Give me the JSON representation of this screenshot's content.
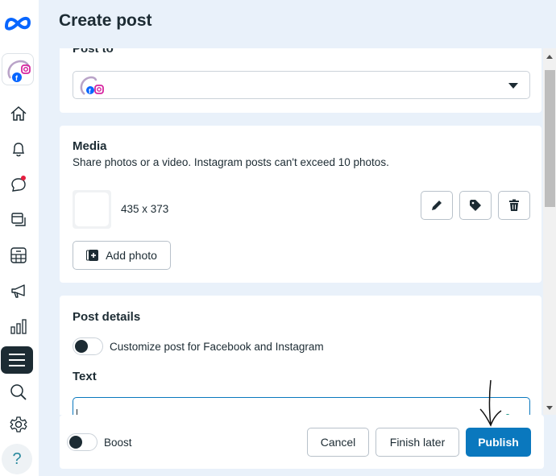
{
  "header": {
    "title": "Create post"
  },
  "sidebar": {
    "items": [
      {
        "name": "home",
        "icon": "home-icon"
      },
      {
        "name": "notifications",
        "icon": "bell-icon"
      },
      {
        "name": "inbox",
        "icon": "chat-bubble-icon",
        "has_badge": true
      },
      {
        "name": "content",
        "icon": "content-stack-icon"
      },
      {
        "name": "planner",
        "icon": "calendar-grid-icon"
      },
      {
        "name": "ads",
        "icon": "megaphone-icon"
      },
      {
        "name": "insights",
        "icon": "bar-chart-icon"
      },
      {
        "name": "all-tools",
        "icon": "hamburger-menu-icon",
        "active": true
      },
      {
        "name": "search",
        "icon": "search-icon"
      },
      {
        "name": "settings",
        "icon": "gear-icon"
      },
      {
        "name": "help",
        "icon": "question-icon",
        "label": "?"
      }
    ]
  },
  "post_to": {
    "title": "Post to",
    "selected_account": ""
  },
  "media": {
    "title": "Media",
    "description": "Share photos or a video. Instagram posts can't exceed 10 photos.",
    "item": {
      "dimensions": "435 x 373"
    },
    "actions": [
      "edit-icon",
      "tag-icon",
      "trash-icon"
    ],
    "add_photo_label": "Add photo"
  },
  "post_details": {
    "title": "Post details",
    "customize_toggle_label": "Customize post for Facebook and Instagram",
    "customize_enabled": false,
    "text_label": "Text",
    "text_value": ""
  },
  "footer": {
    "boost_label": "Boost",
    "boost_enabled": false,
    "cancel_label": "Cancel",
    "finish_later_label": "Finish later",
    "publish_label": "Publish"
  },
  "colors": {
    "primary": "#0a78be",
    "dark": "#1c2b33",
    "badge": "#e41e3f",
    "background": "#e9f1fa"
  }
}
